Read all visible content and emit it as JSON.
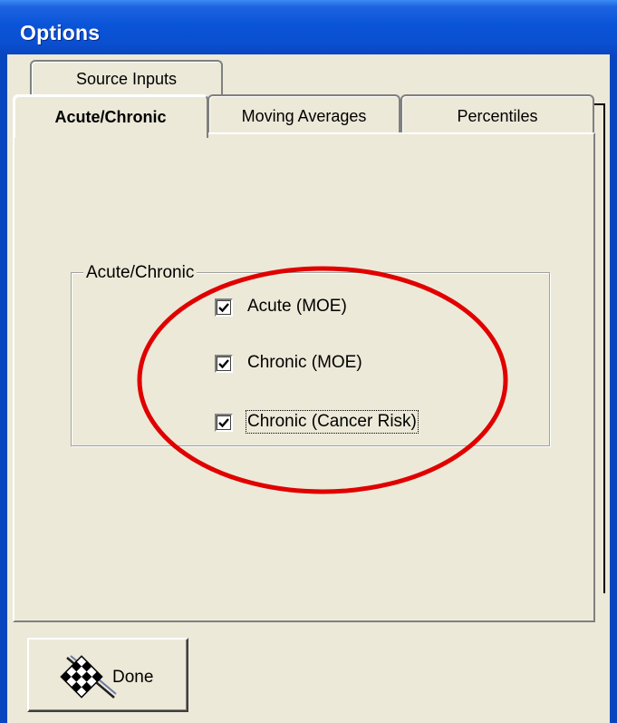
{
  "window": {
    "title": "Options"
  },
  "tabs": {
    "source_inputs": "Source Inputs",
    "acute_chronic": "Acute/Chronic",
    "moving_averages": "Moving Averages",
    "percentiles": "Percentiles"
  },
  "group": {
    "label": "Acute/Chronic",
    "checkboxes": [
      {
        "label": "Acute (MOE)",
        "checked": true
      },
      {
        "label": "Chronic (MOE)",
        "checked": true
      },
      {
        "label": "Chronic (Cancer Risk)",
        "checked": true
      }
    ]
  },
  "done_button": {
    "label": "Done",
    "icon": "checkered-flag-icon"
  },
  "colors": {
    "title_bar": "#0a54d8",
    "face": "#ece9d8",
    "annotation": "#e00000"
  }
}
